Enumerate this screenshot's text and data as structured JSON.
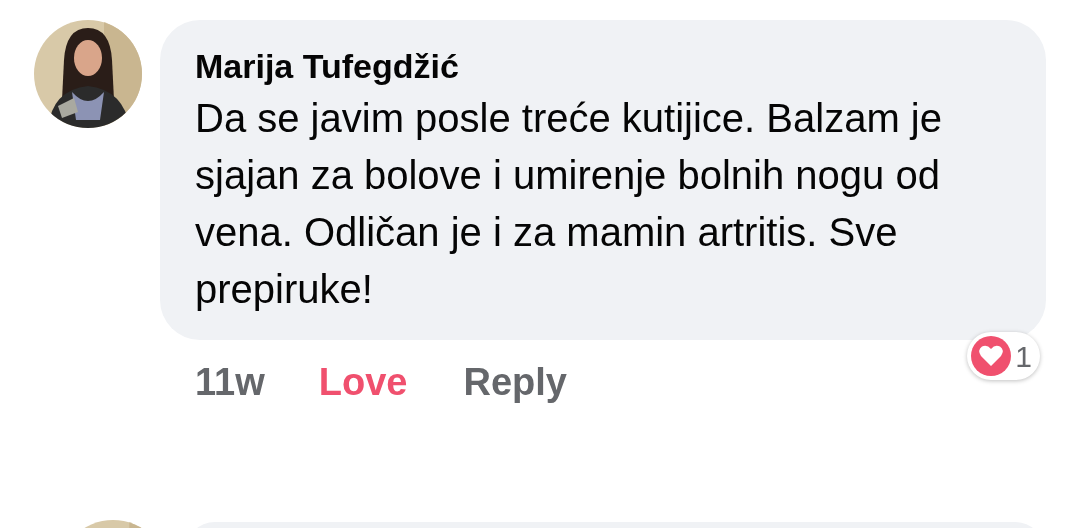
{
  "comment": {
    "author": "Marija Tufegdžić",
    "text": "Da se javim posle treće kutijice. Balzam je sjajan za bolove i umirenje bolnih nogu od vena. Odličan je i za mamin artritis. Sve prepiruke!",
    "time": "11w",
    "reaction_label": "Love",
    "reacted": true,
    "reply_label": "Reply",
    "reaction_count": "1"
  }
}
